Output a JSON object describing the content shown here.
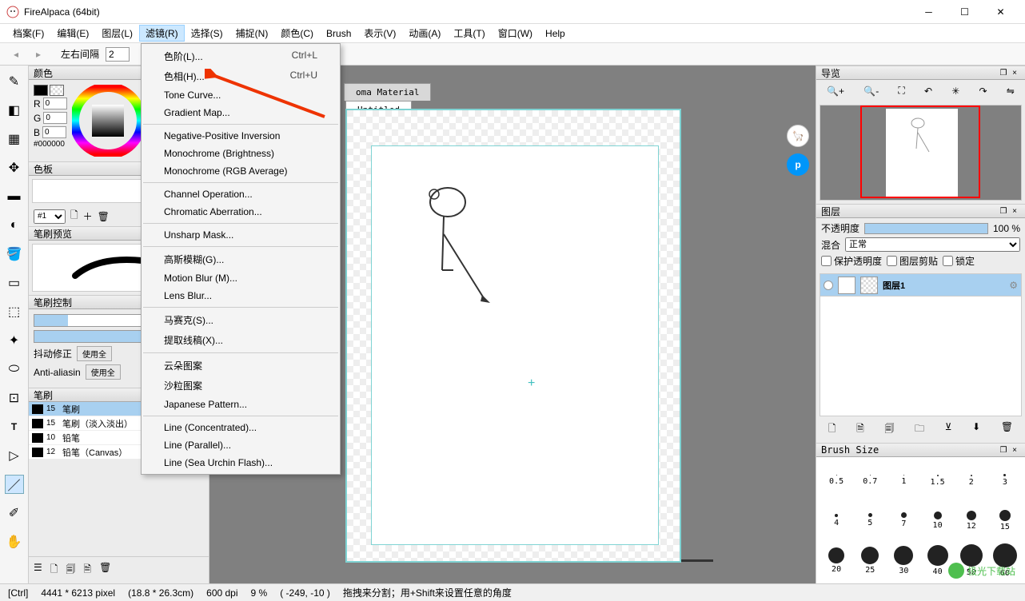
{
  "app": {
    "title": "FireAlpaca (64bit)"
  },
  "menubar": [
    "档案(F)",
    "编辑(E)",
    "图层(L)",
    "滤镜(R)",
    "选择(S)",
    "捕捉(N)",
    "颜色(C)",
    "Brush",
    "表示(V)",
    "动画(A)",
    "工具(T)",
    "窗口(W)",
    "Help"
  ],
  "menubar_active_index": 3,
  "toolbar": {
    "spacing_label": "左右间隔",
    "spacing_value": "2"
  },
  "dropdown": {
    "groups": [
      [
        {
          "label": "色阶(L)...",
          "shortcut": "Ctrl+L"
        },
        {
          "label": "色相(H)...",
          "shortcut": "Ctrl+U"
        },
        {
          "label": "Tone Curve..."
        },
        {
          "label": "Gradient Map..."
        }
      ],
      [
        {
          "label": "Negative-Positive Inversion"
        },
        {
          "label": "Monochrome (Brightness)"
        },
        {
          "label": "Monochrome (RGB Average)"
        }
      ],
      [
        {
          "label": "Channel Operation..."
        },
        {
          "label": "Chromatic Aberration..."
        }
      ],
      [
        {
          "label": "Unsharp Mask..."
        }
      ],
      [
        {
          "label": "高斯模糊(G)..."
        },
        {
          "label": "Motion Blur (M)..."
        },
        {
          "label": "Lens Blur..."
        }
      ],
      [
        {
          "label": "马赛克(S)..."
        },
        {
          "label": "提取线稿(X)..."
        }
      ],
      [
        {
          "label": "云朵图案"
        },
        {
          "label": "沙粒图案"
        },
        {
          "label": "Japanese Pattern..."
        }
      ],
      [
        {
          "label": "Line (Concentrated)..."
        },
        {
          "label": "Line (Parallel)..."
        },
        {
          "label": "Line (Sea Urchin Flash)..."
        }
      ]
    ]
  },
  "panels": {
    "color": {
      "title": "颜色",
      "r_label": "R",
      "g_label": "G",
      "b_label": "B",
      "r": "0",
      "g": "0",
      "b": "0",
      "hex": "#000000",
      "fg": "#000000",
      "bg": "#ffffff"
    },
    "palette": {
      "title": "色板",
      "sel": "#1"
    },
    "brush_preview": {
      "title": "笔刷预览"
    },
    "brush_ctrl": {
      "title": "笔刷控制",
      "stabilize_label": "抖动修正",
      "aa_label": "Anti-aliasin",
      "use_all": "使用全"
    },
    "brush": {
      "title": "笔刷",
      "items": [
        {
          "size": "15",
          "name": "笔刷",
          "sel": true
        },
        {
          "size": "15",
          "name": "笔刷（淡入淡出）"
        },
        {
          "size": "10",
          "name": "铅笔"
        },
        {
          "size": "12",
          "name": "铅笔（Canvas）"
        }
      ]
    },
    "navigator": {
      "title": "导览"
    },
    "layers": {
      "title": "图层",
      "opacity_label": "不透明度",
      "opacity_val": "100 %",
      "blend_label": "混合",
      "blend_mode": "正常",
      "protect_alpha": "保护透明度",
      "clip": "图层剪贴",
      "lock": "锁定",
      "layer1": "图层1"
    },
    "brush_size": {
      "title": "Brush Size",
      "rows": [
        [
          {
            "d": 1,
            "l": "0.5"
          },
          {
            "d": 1,
            "l": "0.7"
          },
          {
            "d": 1,
            "l": "1"
          },
          {
            "d": 2,
            "l": "1.5"
          },
          {
            "d": 2,
            "l": "2"
          },
          {
            "d": 3,
            "l": "3"
          }
        ],
        [
          {
            "d": 4,
            "l": "4"
          },
          {
            "d": 5,
            "l": "5"
          },
          {
            "d": 7,
            "l": "7"
          },
          {
            "d": 10,
            "l": "10"
          },
          {
            "d": 12,
            "l": "12"
          },
          {
            "d": 14,
            "l": "15"
          }
        ],
        [
          {
            "d": 20,
            "l": "20"
          },
          {
            "d": 22,
            "l": "25"
          },
          {
            "d": 24,
            "l": "30"
          },
          {
            "d": 26,
            "l": "40"
          },
          {
            "d": 28,
            "l": "50"
          },
          {
            "d": 30,
            "l": "60"
          }
        ]
      ]
    }
  },
  "tabs": {
    "material": "oma Material",
    "doc": "Untitled"
  },
  "statusbar": {
    "ctrl": "[Ctrl]",
    "dims": "4441 * 6213 pixel",
    "cm": "(18.8 * 26.3cm)",
    "dpi": "600 dpi",
    "zoom": "9 %",
    "coord": "( -249, -10 )",
    "hint": "拖拽来分割；用+Shift来设置任意的角度"
  },
  "watermark": {
    "text": "极光下载站"
  }
}
